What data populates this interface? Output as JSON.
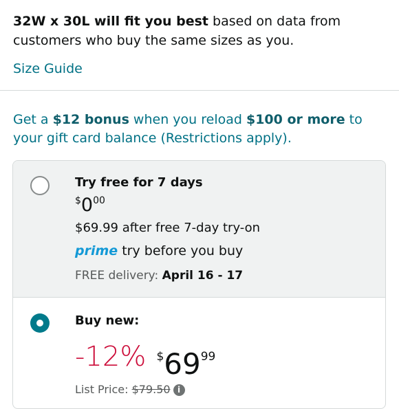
{
  "fit": {
    "size_bold": "32W x 30L will fit you best",
    "rest": " based on data from customers who buy the same sizes as you."
  },
  "size_guide": "Size Guide",
  "promo": {
    "p1": "Get a ",
    "b1": "$12 bonus",
    "p2": " when you reload ",
    "b2": "$100 or more",
    "p3": " to your gift card balance (Restrictions apply)."
  },
  "try_option": {
    "title": "Try free for 7 days",
    "price_currency": "$",
    "price_whole": "0",
    "price_fraction": "00",
    "after_text": "$69.99 after free 7-day try-on",
    "prime_logo": "prime",
    "prime_text": "try before you buy",
    "delivery_label": "FREE delivery: ",
    "delivery_dates": "April 16 - 17"
  },
  "buy_option": {
    "title": "Buy new:",
    "discount": "-12%",
    "price_currency": "$",
    "price_whole": "69",
    "price_fraction": "99",
    "list_label": "List Price: ",
    "list_price": "$79.50"
  },
  "colors": {
    "link": "#007185",
    "discount": "#cc0c39",
    "prime": "#1399d6",
    "radio_selected": "#017a8b"
  }
}
